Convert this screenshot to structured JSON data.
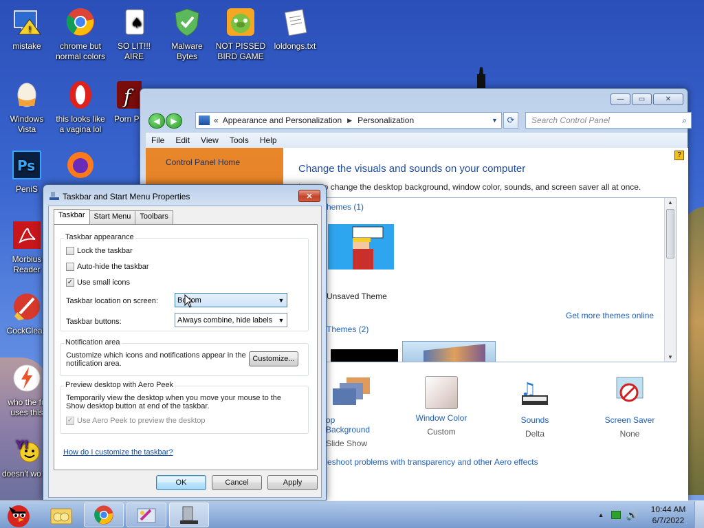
{
  "desktop": {
    "icons": [
      {
        "label": "mistake"
      },
      {
        "label": "chrome but normal colors"
      },
      {
        "label": "SO LIT!!! AIRE"
      },
      {
        "label": "Malware Bytes"
      },
      {
        "label": "NOT PISSED BIRD GAME"
      },
      {
        "label": "loldongs.txt"
      },
      {
        "label": "Windows Vista"
      },
      {
        "label": "this looks like a vagina lol"
      },
      {
        "label": "Porn Pl"
      },
      {
        "label": "PeniS"
      },
      {
        "label": "Morbius Reader"
      },
      {
        "label": "CockClean"
      },
      {
        "label": "who the fu uses this"
      },
      {
        "label": "doesn't wo lol"
      }
    ]
  },
  "control_panel": {
    "breadcrumb_prefix": "«",
    "breadcrumb_1": "Appearance and Personalization",
    "breadcrumb_2": "Personalization",
    "search_placeholder": "Search Control Panel",
    "menu": [
      "File",
      "Edit",
      "View",
      "Tools",
      "Help"
    ],
    "sidebar_home": "Control Panel Home",
    "heading": "Change the visuals and sounds on your computer",
    "subheading": "heme to change the desktop background, window color, sounds, and screen saver all at once.",
    "my_themes": "hemes (1)",
    "unsaved_theme": "Unsaved Theme",
    "get_more": "Get more themes online",
    "installed_themes": "Themes (2)",
    "bottom_items": [
      {
        "title": "op Background",
        "sub": "Slide Show"
      },
      {
        "title": "Window Color",
        "sub": "Custom"
      },
      {
        "title": "Sounds",
        "sub": "Delta"
      },
      {
        "title": "Screen Saver",
        "sub": "None"
      }
    ],
    "troubleshoot": "ubleshoot problems with transparency and other Aero effects"
  },
  "dialog": {
    "title": "Taskbar and Start Menu Properties",
    "tabs": [
      "Taskbar",
      "Start Menu",
      "Toolbars"
    ],
    "appearance_group": "Taskbar appearance",
    "lock": "Lock the taskbar",
    "autohide": "Auto-hide the taskbar",
    "small_icons": "Use small icons",
    "location_label": "Taskbar location on screen:",
    "location_value": "Bottom",
    "buttons_label": "Taskbar buttons:",
    "buttons_value": "Always combine, hide labels",
    "notif_group": "Notification area",
    "notif_text": "Customize which icons and notifications appear in the notification area.",
    "customize_btn": "Customize...",
    "peek_group": "Preview desktop with Aero Peek",
    "peek_text": "Temporarily view the desktop when you move your mouse to the Show desktop button at end of the taskbar.",
    "peek_checkbox": "Use Aero Peek to preview the desktop",
    "help_link": "How do I customize the taskbar?",
    "ok": "OK",
    "cancel": "Cancel",
    "apply": "Apply",
    "checked_small_icons": true,
    "checked_lock": false,
    "checked_autohide": false,
    "checked_peek": true
  },
  "taskbar": {
    "time": "10:44 AM",
    "date": "6/7/2022"
  }
}
